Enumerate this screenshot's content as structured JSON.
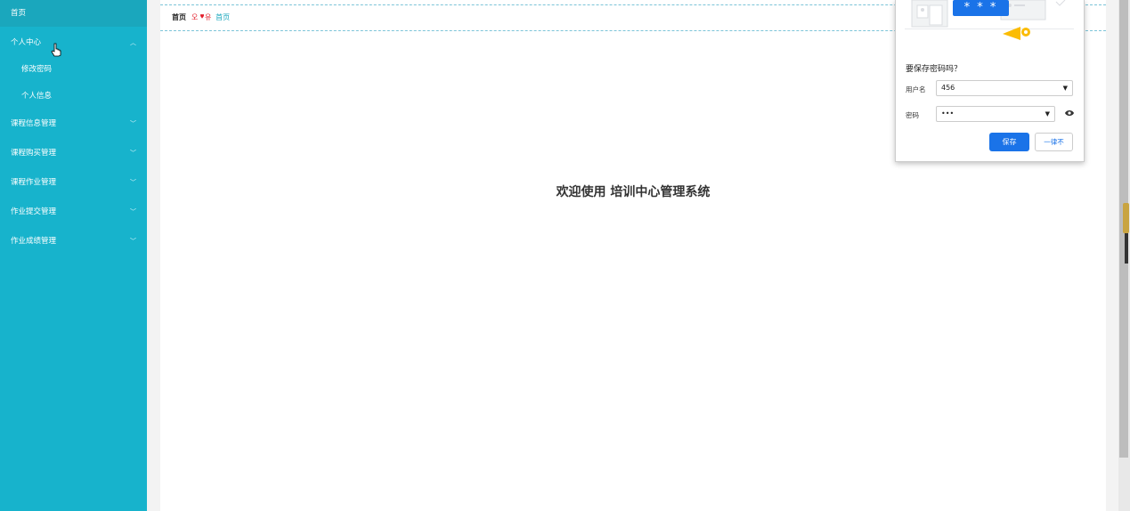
{
  "sidebar": {
    "home": "首页",
    "personal_center": "个人中心",
    "sub_items": [
      "修改密码",
      "个人信息"
    ],
    "items": [
      "课程信息管理",
      "课程购买管理",
      "课程作业管理",
      "作业提交管理",
      "作业成绩管理"
    ]
  },
  "breadcrumb": {
    "home": "首页",
    "separator": "",
    "current": "首页"
  },
  "main": {
    "welcome": "欢迎使用 培训中心管理系统"
  },
  "password_popup": {
    "title": "要保存密码吗？",
    "username_label": "用户名",
    "username_value": "456",
    "password_label": "密码",
    "password_value": "•••",
    "masked_preview": "* * *",
    "save_button": "保存",
    "never_button": "一律不"
  },
  "colors": {
    "sidebar_bg": "#17b3cc",
    "accent_blue": "#1a73e8",
    "breadcrumb_separator": "#e21d2a"
  }
}
